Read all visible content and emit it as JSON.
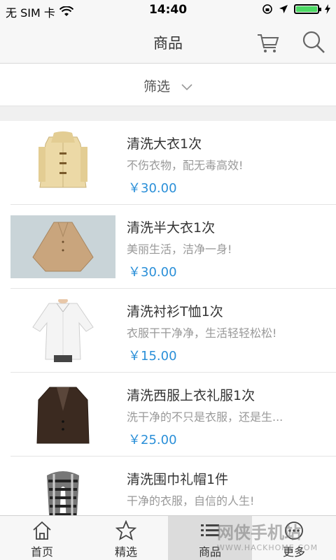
{
  "status_bar": {
    "carrier": "无 SIM 卡",
    "time": "14:40"
  },
  "nav": {
    "title": "商品",
    "cart_icon": "cart-icon",
    "search_icon": "search-icon"
  },
  "filter": {
    "label": "筛选",
    "icon": "chevron-down-icon"
  },
  "products": [
    {
      "name": "清洗大衣1次",
      "desc": "不伤衣物，配无毒高效!",
      "price": "￥30.00",
      "image": "beige-duffle-coat"
    },
    {
      "name": "清洗半大衣1次",
      "desc": "美丽生活，洁净一身!",
      "price": "￥30.00",
      "image": "camel-cape-coat"
    },
    {
      "name": "清洗衬衫T恤1次",
      "desc": "衣服干干净净，生活轻轻松松!",
      "price": "￥15.00",
      "image": "white-shirt"
    },
    {
      "name": "清洗西服上衣礼服1次",
      "desc": "洗干净的不只是衣服，还是生...",
      "price": "￥25.00",
      "image": "dark-suit-jacket"
    },
    {
      "name": "清洗围巾礼帽1件",
      "desc": "干净的衣服，自信的人生!",
      "price": "",
      "image": "plaid-scarf"
    }
  ],
  "tabs": [
    {
      "label": "首页",
      "icon": "home-icon"
    },
    {
      "label": "精选",
      "icon": "star-icon"
    },
    {
      "label": "商品",
      "icon": "list-icon"
    },
    {
      "label": "更多",
      "icon": "more-icon"
    }
  ],
  "watermark": {
    "text": "网侠手机站",
    "url": "WWW.HACKHOME.COM"
  },
  "colors": {
    "price": "#2a8fd8",
    "battery": "#4cd964"
  }
}
